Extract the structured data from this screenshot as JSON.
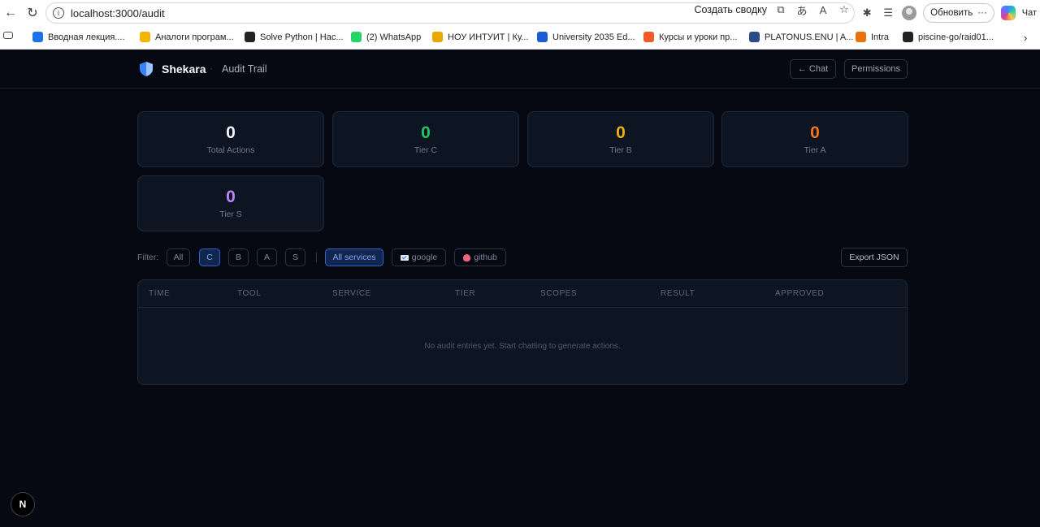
{
  "browser": {
    "url": "localhost:3000/audit",
    "summary_label": "Создать сводку",
    "update_label": "Обновить",
    "sidebar_label": "Чат",
    "bookmarks": [
      {
        "label": "Вводная лекция....",
        "color": "#1a73e8"
      },
      {
        "label": "Аналоги програм...",
        "color": "#f4b400"
      },
      {
        "label": "Solve Python | Hac...",
        "color": "#222222"
      },
      {
        "label": "(2) WhatsApp",
        "color": "#25d366"
      },
      {
        "label": "НОУ ИНТУИТ | Ку...",
        "color": "#e8a800"
      },
      {
        "label": "University 2035 Ed...",
        "color": "#1a5cd6"
      },
      {
        "label": "Курсы и уроки пр...",
        "color": "#f05a28"
      },
      {
        "label": "PLATONUS.ENU | A...",
        "color": "#2a4a8a"
      },
      {
        "label": "Intra",
        "color": "#e8710a"
      },
      {
        "label": "piscine-go/raid01...",
        "color": "#222222"
      }
    ]
  },
  "header": {
    "brand": "Shekara",
    "separator": "·",
    "page": "Audit Trail",
    "chat_button": "← Chat",
    "permissions_button": "Permissions"
  },
  "stats": [
    {
      "value": "0",
      "label": "Total Actions",
      "color": "#f3f5f8"
    },
    {
      "value": "0",
      "label": "Tier C",
      "color": "#22c55e"
    },
    {
      "value": "0",
      "label": "Tier B",
      "color": "#eab308"
    },
    {
      "value": "0",
      "label": "Tier A",
      "color": "#f97316"
    },
    {
      "value": "0",
      "label": "Tier S",
      "color": "#c084fc"
    }
  ],
  "filters": {
    "label": "Filter:",
    "tiers": [
      "All",
      "C",
      "B",
      "A",
      "S"
    ],
    "active_tier": "C",
    "services": [
      "All services",
      "google",
      "github"
    ],
    "active_service": "All services",
    "export_label": "Export JSON"
  },
  "table": {
    "columns": [
      "TIME",
      "TOOL",
      "SERVICE",
      "TIER",
      "SCOPES",
      "RESULT",
      "APPROVED"
    ],
    "empty_message": "No audit entries yet. Start chatting to generate actions."
  },
  "dev_badge": "N"
}
